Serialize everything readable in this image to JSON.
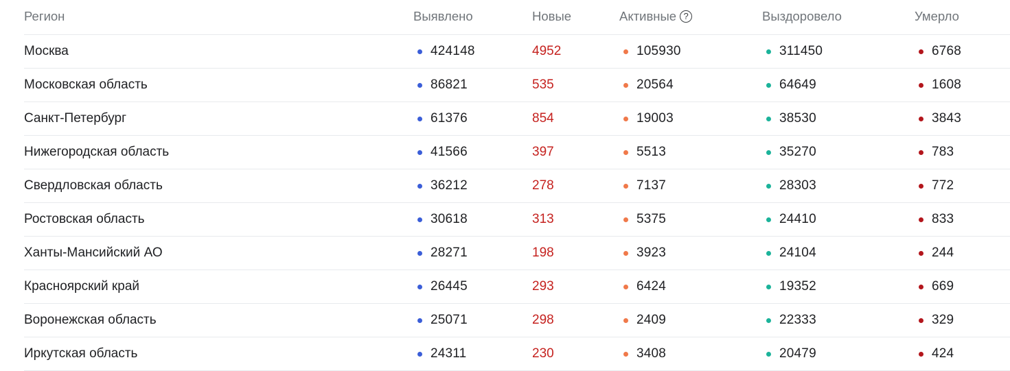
{
  "colors": {
    "confirmed": "#3b5ed8",
    "active": "#f0794a",
    "recovered": "#1bb39a",
    "deaths": "#b3161c",
    "new": "#c5221f"
  },
  "header": {
    "region": "Регион",
    "confirmed": "Выявлено",
    "new": "Новые",
    "active": "Активные",
    "active_help_icon": "question-mark-icon",
    "active_help_glyph": "?",
    "recovered": "Выздоровело",
    "deaths": "Умерло"
  },
  "rows": [
    {
      "region": "Москва",
      "confirmed": "424148",
      "new": "4952",
      "active": "105930",
      "recovered": "311450",
      "deaths": "6768"
    },
    {
      "region": "Московская область",
      "confirmed": "86821",
      "new": "535",
      "active": "20564",
      "recovered": "64649",
      "deaths": "1608"
    },
    {
      "region": "Санкт-Петербург",
      "confirmed": "61376",
      "new": "854",
      "active": "19003",
      "recovered": "38530",
      "deaths": "3843"
    },
    {
      "region": "Нижегородская область",
      "confirmed": "41566",
      "new": "397",
      "active": "5513",
      "recovered": "35270",
      "deaths": "783"
    },
    {
      "region": "Свердловская область",
      "confirmed": "36212",
      "new": "278",
      "active": "7137",
      "recovered": "28303",
      "deaths": "772"
    },
    {
      "region": "Ростовская область",
      "confirmed": "30618",
      "new": "313",
      "active": "5375",
      "recovered": "24410",
      "deaths": "833"
    },
    {
      "region": "Ханты-Мансийский АО",
      "confirmed": "28271",
      "new": "198",
      "active": "3923",
      "recovered": "24104",
      "deaths": "244"
    },
    {
      "region": "Красноярский край",
      "confirmed": "26445",
      "new": "293",
      "active": "6424",
      "recovered": "19352",
      "deaths": "669"
    },
    {
      "region": "Воронежская область",
      "confirmed": "25071",
      "new": "298",
      "active": "2409",
      "recovered": "22333",
      "deaths": "329"
    },
    {
      "region": "Иркутская область",
      "confirmed": "24311",
      "new": "230",
      "active": "3408",
      "recovered": "20479",
      "deaths": "424"
    }
  ]
}
